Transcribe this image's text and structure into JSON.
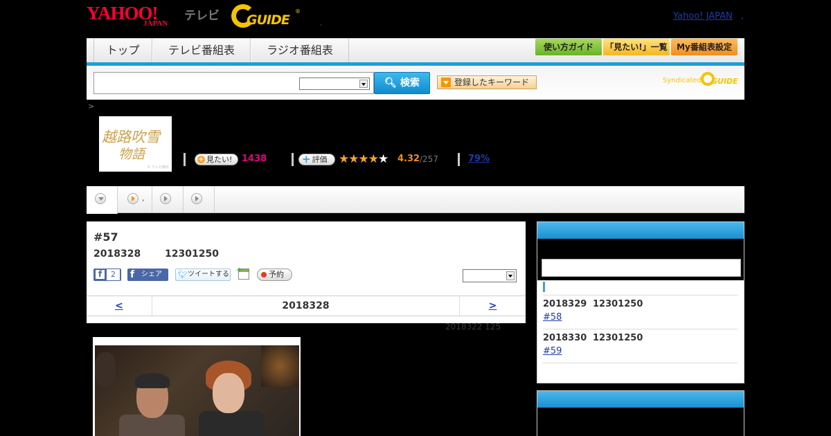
{
  "header": {
    "brand_yahoo": "YAHOO!",
    "brand_japan": "JAPAN",
    "brand_tv": "テレビ",
    "brand_gguide": "GUIDE",
    "gguide_reg": "®",
    "tiny_dot": ",",
    "yahoo_japan_link": "Yahoo! JAPAN",
    "yahoo_japan_dot": ","
  },
  "nav": {
    "tabs": [
      "トップ",
      "テレビ番組表",
      "ラジオ番組表"
    ],
    "buttons": [
      "使い方ガイド",
      "「見たい!」一覧",
      "My番組表設定"
    ]
  },
  "search": {
    "button_label": "検索",
    "keyword_button": "登録したキーワード",
    "syndicated": "Syndicated"
  },
  "breadcrumb_sep": ">",
  "program": {
    "thumb_title_1": "越路吹雪",
    "thumb_title_2": "物語",
    "thumb_copy": "© テレビ朝日",
    "mitai_label": "見たい!",
    "mitai_count": "1438",
    "rating_label": "評価",
    "rating_score": "4.32",
    "rating_total": "/257",
    "rating_stars": 4.32,
    "percent": "79%"
  },
  "subtabs": {
    "dot": ","
  },
  "episode": {
    "number": "#57",
    "date": "2018328",
    "time": "12301250",
    "fb_like_count": "2",
    "fb_share": "シェア",
    "tweet": "ツイートする",
    "reserve": "予約",
    "pager_prev": "<",
    "pager_date": "2018328",
    "pager_next": ">",
    "faded_note": "2018322  125"
  },
  "sidebar": {
    "items": [
      {
        "date": "2018329",
        "time": "12301250",
        "ep": "#58"
      },
      {
        "date": "2018330",
        "time": "12301250",
        "ep": "#59"
      }
    ]
  },
  "colors": {
    "accent_blue": "#1e9ed8",
    "brand_red": "#ff0033",
    "gguide_yellow": "#f5c400",
    "mitai_pink": "#e4007f",
    "star_orange": "#f5a623"
  }
}
